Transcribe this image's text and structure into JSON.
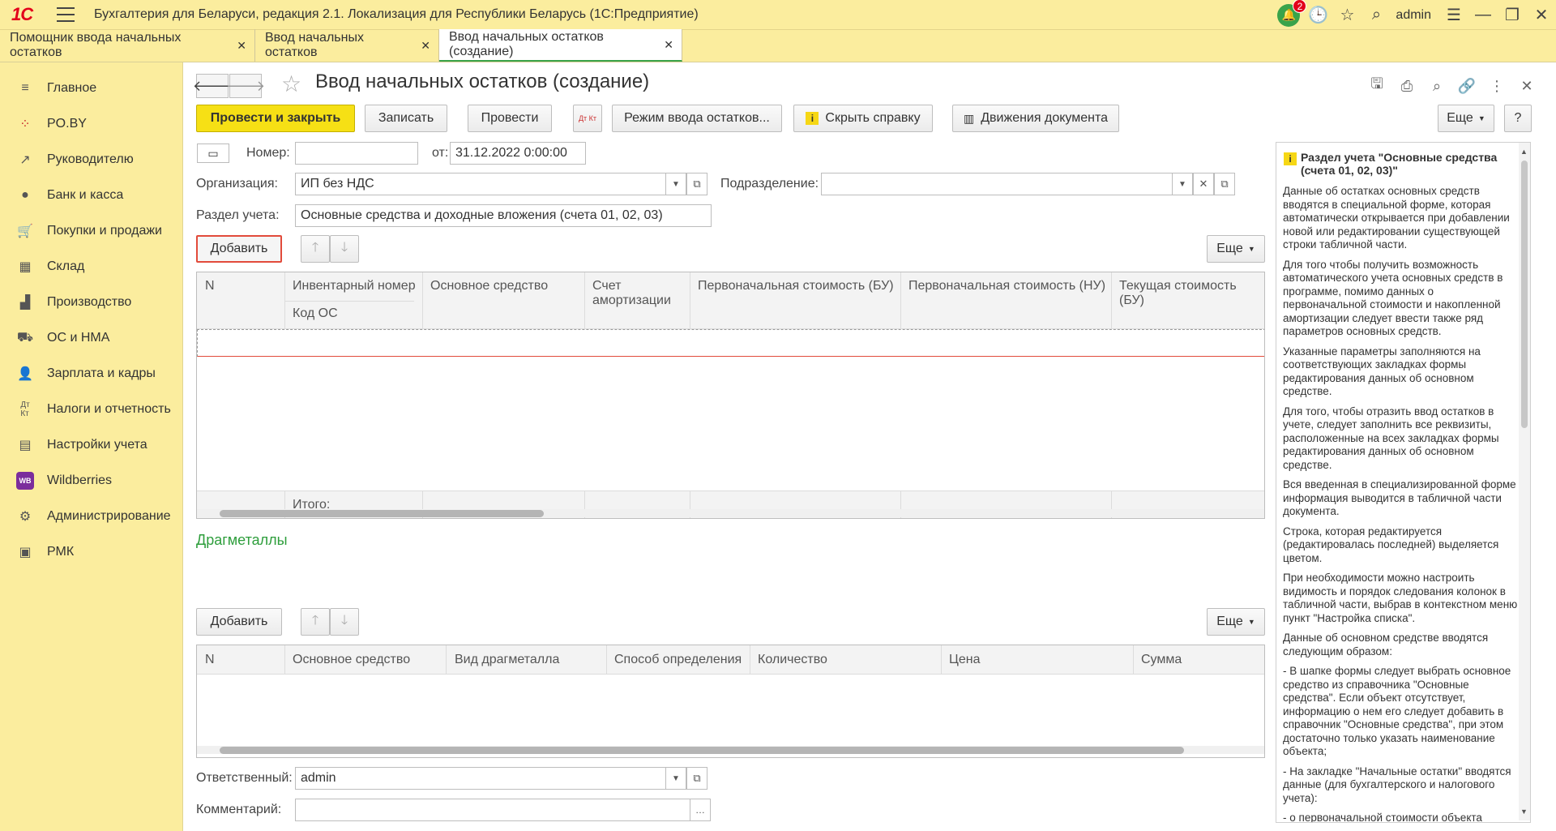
{
  "app": {
    "title": "Бухгалтерия для Беларуси, редакция 2.1. Локализация для Республики Беларусь  (1С:Предприятие)",
    "logo_text": "1С",
    "user": "admin",
    "notifications": "2"
  },
  "tabs": [
    {
      "label": "Помощник ввода начальных остатков"
    },
    {
      "label": "Ввод начальных остатков"
    },
    {
      "label": "Ввод начальных остатков (создание)"
    }
  ],
  "sidebar": {
    "items": [
      {
        "label": "Главное",
        "icon": "menu-icon"
      },
      {
        "label": "PO.BY",
        "icon": "dots-icon"
      },
      {
        "label": "Руководителю",
        "icon": "trend-icon"
      },
      {
        "label": "Банк и касса",
        "icon": "coin-icon"
      },
      {
        "label": "Покупки и продажи",
        "icon": "cart-icon"
      },
      {
        "label": "Склад",
        "icon": "warehouse-icon"
      },
      {
        "label": "Производство",
        "icon": "factory-icon"
      },
      {
        "label": "ОС и НМА",
        "icon": "truck-icon"
      },
      {
        "label": "Зарплата и кадры",
        "icon": "person-icon"
      },
      {
        "label": "Налоги и отчетность",
        "icon": "dtkt-icon"
      },
      {
        "label": "Настройки учета",
        "icon": "book-icon"
      },
      {
        "label": "Wildberries",
        "icon": "wb-icon"
      },
      {
        "label": "Администрирование",
        "icon": "gear-icon"
      },
      {
        "label": "РМК",
        "icon": "register-icon"
      }
    ]
  },
  "doc": {
    "title": "Ввод начальных остатков (создание)"
  },
  "toolbar": {
    "post_close": "Провести и закрыть",
    "write": "Записать",
    "post": "Провести",
    "dtkt": "Дт Кт",
    "mode": "Режим ввода остатков...",
    "hide_help": "Скрыть справку",
    "movements": "Движения документа",
    "more": "Еще",
    "help": "?"
  },
  "form": {
    "number_label": "Номер:",
    "number_value": "",
    "date_label": "от:",
    "date_value": "31.12.2022  0:00:00",
    "org_label": "Организация:",
    "org_value": "ИП без НДС",
    "division_label": "Подразделение:",
    "division_value": "",
    "section_label": "Раздел учета:",
    "section_value": "Основные средства и доходные вложения (счета 01, 02, 03)",
    "responsible_label": "Ответственный:",
    "responsible_value": "admin",
    "comment_label": "Комментарий:",
    "comment_value": ""
  },
  "table1": {
    "add": "Добавить",
    "more": "Еще",
    "columns": [
      "N",
      "Инвентарный номер",
      "Основное средство",
      "Счет амортизации",
      "Первоначальная стоимость (БУ)",
      "Первоначальная стоимость (НУ)",
      "Текущая стоимость (БУ)"
    ],
    "subcolumn": "Код ОС",
    "total_label": "Итого:"
  },
  "table2": {
    "title": "Драгметаллы",
    "add": "Добавить",
    "more": "Еще",
    "columns": [
      "N",
      "Основное средство",
      "Вид драгметалла",
      "Способ определения",
      "Количество",
      "Цена",
      "Сумма"
    ]
  },
  "help": {
    "title": "Раздел учета \"Основные средства (счета 01, 02, 03)\"",
    "paragraphs": [
      "Данные об остатках основных средств вводятся в специальной форме, которая автоматически открывается при добавлении новой или редактировании существующей строки табличной части.",
      "Для того чтобы получить возможность автоматического учета основных средств в программе, помимо данных о первоначальной стоимости и накопленной амортизации следует ввести также ряд параметров основных средств.",
      "Указанные параметры заполняются на соответствующих закладках формы редактирования данных об основном средстве.",
      "Для того, чтобы отразить ввод остатков в учете, следует заполнить все реквизиты, расположенные на всех закладках формы редактирования данных об основном средстве.",
      "Вся введенная в специализированной форме информация выводится в табличной части документа.",
      "Строка, которая редактируется (редактировалась последней) выделяется цветом.",
      "При необходимости можно настроить видимость и порядок следования колонок в табличной части, выбрав в контекстном меню пункт \"Настройка списка\".",
      "Данные об основном средстве вводятся следующим образом:",
      "- В шапке формы следует выбрать основное средство из справочника \"Основные средства\". Если объект отсутствует, информацию о нем его следует добавить в справочник \"Основные средства\", при этом достаточно только указать наименование объекта;",
      "- На закладке \"Начальные остатки\" вводятся данные (для бухгалтерского и налогового учета):",
      "- о первоначальной стоимости объекта основных средств (на момент ввода его в"
    ]
  }
}
